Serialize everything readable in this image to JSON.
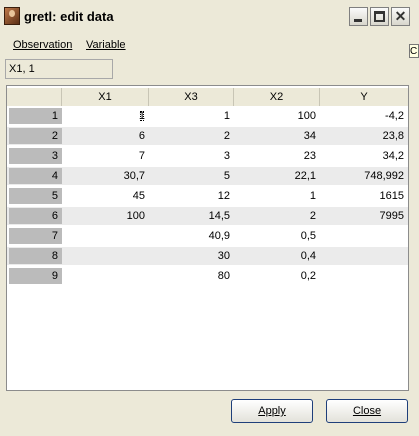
{
  "window": {
    "title": "gretl: edit data",
    "close_glyph": "✕",
    "edge_glyph": "C"
  },
  "menu": {
    "observation": "Observation",
    "variable": "Variable"
  },
  "cell_ref": "X1, 1",
  "columns": [
    "",
    "X1",
    "X3",
    "X2",
    "Y"
  ],
  "rows": [
    {
      "n": "1",
      "x1": "1",
      "x3": "1",
      "x2": "100",
      "y": "-4,2"
    },
    {
      "n": "2",
      "x1": "6",
      "x3": "2",
      "x2": "34",
      "y": "23,8"
    },
    {
      "n": "3",
      "x1": "7",
      "x3": "3",
      "x2": "23",
      "y": "34,2"
    },
    {
      "n": "4",
      "x1": "30,7",
      "x3": "5",
      "x2": "22,1",
      "y": "748,992"
    },
    {
      "n": "5",
      "x1": "45",
      "x3": "12",
      "x2": "1",
      "y": "1615"
    },
    {
      "n": "6",
      "x1": "100",
      "x3": "14,5",
      "x2": "2",
      "y": "7995"
    },
    {
      "n": "7",
      "x1": "",
      "x3": "40,9",
      "x2": "0,5",
      "y": ""
    },
    {
      "n": "8",
      "x1": "",
      "x3": "30",
      "x2": "0,4",
      "y": ""
    },
    {
      "n": "9",
      "x1": "",
      "x3": "80",
      "x2": "0,2",
      "y": ""
    }
  ],
  "buttons": {
    "apply": "Apply",
    "close": "Close"
  }
}
